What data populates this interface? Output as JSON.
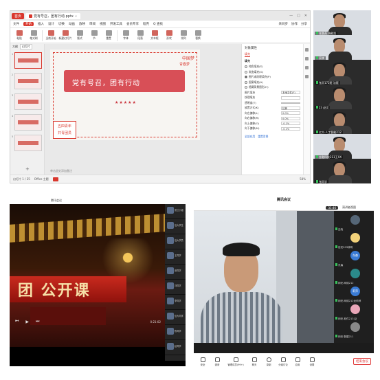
{
  "wps": {
    "home_tab": "首页",
    "doc_tab": "党有号召，团有行动.pptx",
    "menu": [
      "文件",
      "开始",
      "插入",
      "设计",
      "切换",
      "动画",
      "放映",
      "审阅",
      "视图",
      "开发工具",
      "会员专享",
      "稻壳",
      "Q 查找"
    ],
    "menu_right": [
      "未同步",
      "协作",
      "分享"
    ],
    "ribbon": [
      "粘贴",
      "格式刷",
      "当前开始",
      "新建幻灯片",
      "版式",
      "节",
      "重置",
      "字体",
      "段落",
      "文本框",
      "形状",
      "排列",
      "替换"
    ],
    "thumb_tabs": [
      "大纲",
      "幻灯片"
    ],
    "slide": {
      "banner_text": "党有号召，团有行动",
      "stamp_line1": "中国梦",
      "stamp_line2": "青春梦",
      "stars": "★★★★★",
      "seal_line1": "五四青年",
      "seal_line2": "共青团员"
    },
    "notes_placeholder": "单击此处添加备注",
    "props": {
      "title": "对象属性",
      "tabs": [
        "填充"
      ],
      "section": "填充",
      "options": [
        "纯色填充(S)",
        "渐变填充(G)",
        "图片或纹理填充(P)",
        "图案填充(A)",
        "隐藏背景图形(H)"
      ],
      "fields": [
        {
          "label": "图片填充",
          "value": "本地文件(F)"
        },
        {
          "label": "纹理填充",
          "value": ""
        },
        {
          "label": "透明度(T)",
          "value": "0%"
        },
        {
          "label": "放置方式(K)",
          "value": "拉伸"
        },
        {
          "label": "向左偏移(L)",
          "value": "0.0%"
        },
        {
          "label": "向右偏移(R)",
          "value": "0.0%"
        },
        {
          "label": "向上偏移(O)",
          "value": "-0.1%"
        },
        {
          "label": "向下偏移(M)",
          "value": "-0.1%"
        }
      ],
      "buttons": [
        "全部应用",
        "重置背景"
      ]
    },
    "status": {
      "slide_count": "幻灯片 1 / 25",
      "theme": "Office 主题",
      "zoom": "58%"
    }
  },
  "participants_top": [
    {
      "name": "张晨燕 施能凯"
    },
    {
      "name": "吴晓"
    },
    {
      "name": "张灵172班 法医"
    },
    {
      "name": "23 赵文"
    },
    {
      "name": "亿大·人工智能212"
    },
    {
      "name": "金融科技211王XX"
    },
    {
      "name": "张同学"
    }
  ],
  "video": {
    "top_label": "腾讯会议",
    "title_text": "团 公开课",
    "time": "0:21:02",
    "list": [
      "张兰小组",
      "信大学生",
      "信大学员",
      "王同学",
      "张同学",
      "刘同学",
      "李同学",
      "信大同学",
      "陈同学",
      "赵同学"
    ]
  },
  "meeting": {
    "title": "腾讯会议",
    "time": "31:46",
    "view": "演讲者视图",
    "participants": [
      {
        "name": "吕晓",
        "label": ""
      },
      {
        "name": "信安203",
        "label": "信安203徐明"
      },
      {
        "name": "东森",
        "label": "东森"
      },
      {
        "name": "网安-网络212",
        "label": "网安-网络212"
      },
      {
        "name": "莉萍",
        "label": "网安-网络212龙莉萍"
      },
      {
        "name": "网安-软件213",
        "label": "网安-软件213 赵"
      },
      {
        "name": "网安",
        "label": "网安·数据211"
      }
    ],
    "toolbar": [
      "安全",
      "邀请",
      "管理成员(99+)",
      "聊天",
      "录制",
      "分组讨论",
      "应用",
      "设置"
    ],
    "end_label": "结束会议"
  },
  "colors": {
    "wps_red": "#d9372d",
    "tm_bg": "#1c1c1c",
    "end_red": "#e03b3b"
  }
}
